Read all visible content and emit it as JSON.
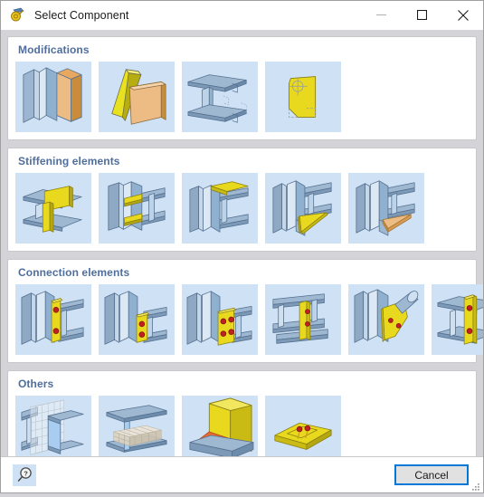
{
  "window": {
    "title": "Select Component",
    "icon": "component-app-icon",
    "controls": {
      "minimize": "minimize-icon",
      "maximize": "maximize-icon",
      "close": "close-icon"
    }
  },
  "sections": [
    {
      "title": "Modifications",
      "tiles": [
        {
          "name": "beam-end-plate-cut",
          "kind": "beam-plate"
        },
        {
          "name": "folded-plate-pair",
          "kind": "folded-plates"
        },
        {
          "name": "beam-flange-notch",
          "kind": "beam-notch"
        },
        {
          "name": "plate-contour-edit",
          "kind": "plate-contour"
        }
      ]
    },
    {
      "title": "Stiffening elements",
      "tiles": [
        {
          "name": "vertical-stiffener-plate",
          "kind": "stiff-vertical"
        },
        {
          "name": "double-horizontal-stiffeners",
          "kind": "stiff-double"
        },
        {
          "name": "top-flange-stiffener",
          "kind": "stiff-top"
        },
        {
          "name": "triangular-yellow-haunch",
          "kind": "haunch-yellow"
        },
        {
          "name": "triangular-orange-haunch",
          "kind": "haunch-orange"
        }
      ]
    },
    {
      "title": "Connection elements",
      "tiles": [
        {
          "name": "end-plate-two-bolts",
          "kind": "conn-endplate-2"
        },
        {
          "name": "fin-plate-two-bolts",
          "kind": "conn-finplate-2"
        },
        {
          "name": "end-plate-four-bolts",
          "kind": "conn-endplate-4"
        },
        {
          "name": "column-web-angle-cleat",
          "kind": "conn-cleat"
        },
        {
          "name": "diagonal-tube-gusset-plate",
          "kind": "conn-gusset-tube"
        },
        {
          "name": "column-flange-bolted-plate",
          "kind": "conn-flange-plate"
        }
      ]
    },
    {
      "title": "Others",
      "tiles": [
        {
          "name": "concrete-wall-embed",
          "kind": "other-wall"
        },
        {
          "name": "concrete-beam-embed",
          "kind": "other-beam"
        },
        {
          "name": "weld-seam-detail",
          "kind": "other-weld"
        },
        {
          "name": "anchor-base-plate",
          "kind": "other-anchor"
        }
      ]
    }
  ],
  "footer": {
    "help_search_icon": "search-help-icon",
    "cancel_label": "Cancel",
    "resize_grip": "resize-grip-icon"
  },
  "colors": {
    "dialog_bg": "#d4d4d8",
    "panel_bg": "#ffffff",
    "section_title": "#4f6e9e",
    "tile_bg": "#cfe2f5",
    "accent": "#0078d7",
    "steel_blue": "#8ba6c4",
    "steel_dark": "#5c7694",
    "plate_yellow": "#e8d91e",
    "plate_orange": "#e0a264",
    "bolt_red": "#c02020",
    "weld_orange": "#f05a28"
  }
}
